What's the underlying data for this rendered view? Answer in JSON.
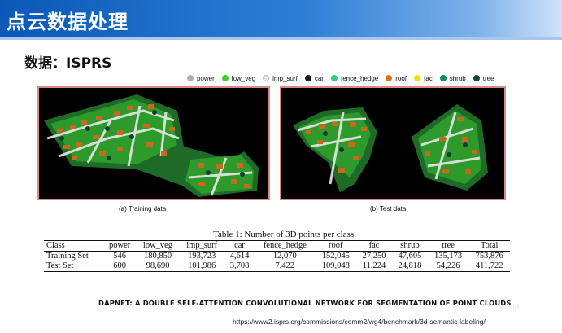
{
  "header": {
    "title": "点云数据处理"
  },
  "section": {
    "title": "数据：ISPRS"
  },
  "legend": [
    {
      "label": "power",
      "color": "#b0b0b0"
    },
    {
      "label": "low_veg",
      "color": "#3ccf2a"
    },
    {
      "label": "imp_surf",
      "color": "#e6e6e6"
    },
    {
      "label": "car",
      "color": "#1a1a1a"
    },
    {
      "label": "fence_hedge",
      "color": "#2fd07a"
    },
    {
      "label": "roof",
      "color": "#e0701a"
    },
    {
      "label": "fac",
      "color": "#f2e200"
    },
    {
      "label": "shrub",
      "color": "#138a6a"
    },
    {
      "label": "tree",
      "color": "#0d4a3a"
    }
  ],
  "figure": {
    "caption_train": "(a) Training data",
    "caption_test": "(b) Test data"
  },
  "table": {
    "caption": "Table 1: Number of 3D points per class.",
    "headers": [
      "Class",
      "power",
      "low_veg",
      "imp_surf",
      "car",
      "fence_hedge",
      "roof",
      "fac",
      "shrub",
      "tree",
      "Total"
    ],
    "rows": [
      [
        "Training Set",
        "546",
        "180,850",
        "193,723",
        "4,614",
        "12,070",
        "152,045",
        "27,250",
        "47,605",
        "135,173",
        "753,876"
      ],
      [
        "Test Set",
        "600",
        "98,690",
        "101,986",
        "3,708",
        "7,422",
        "109,048",
        "11,224",
        "24,818",
        "54,226",
        "411,722"
      ]
    ]
  },
  "paper_title": "DAPNET: A DOUBLE SELF-ATTENTION CONVOLUTIONAL NETWORK FOR SEGMENTATION OF POINT CLOUDS",
  "url": "https://www2.isprs.org/commissions/comm2/wg4/benchmark/3d-semantic-labeling/",
  "watermark": "ricia"
}
